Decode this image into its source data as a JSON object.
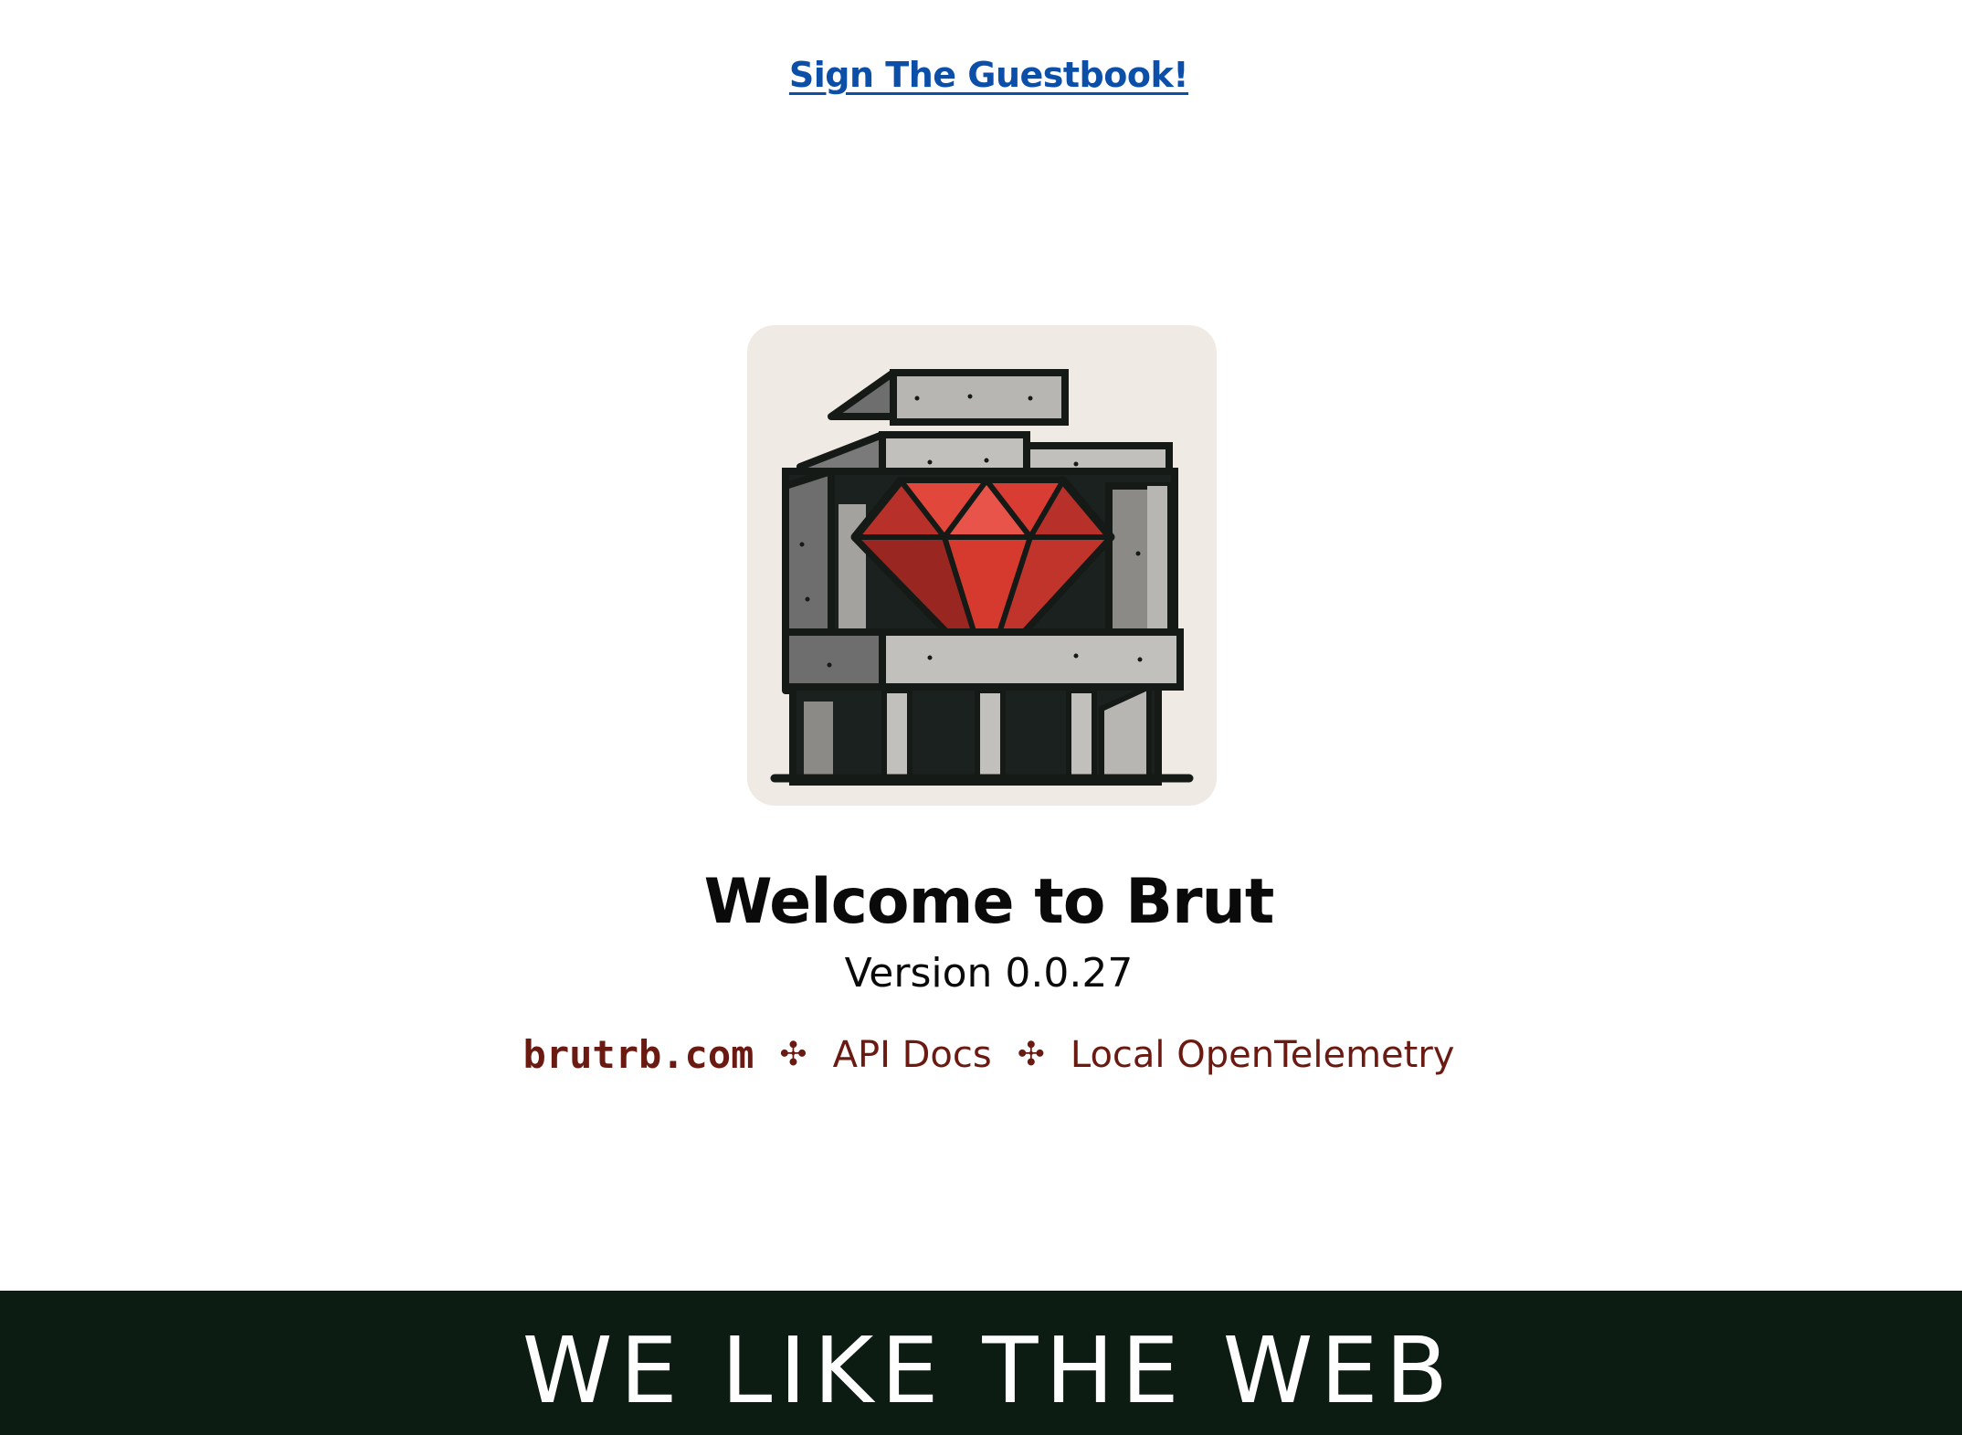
{
  "header": {
    "guestbook_link": "Sign The Guestbook!"
  },
  "hero": {
    "logo_icon": "brutalist-building-ruby-gem-logo",
    "title": "Welcome to Brut",
    "version": "Version 0.0.27"
  },
  "links": {
    "site": "brutrb.com",
    "separator_1": "✣",
    "api_docs": "API Docs",
    "separator_2": "✣",
    "telemetry": "Local OpenTelemetry"
  },
  "banner": {
    "text": "WE LIKE THE WEB"
  },
  "colors": {
    "link_blue": "#0b4fa8",
    "link_red": "#6b1a12",
    "banner_bg": "#0d1c12",
    "gem_red": "#d63a2f"
  }
}
